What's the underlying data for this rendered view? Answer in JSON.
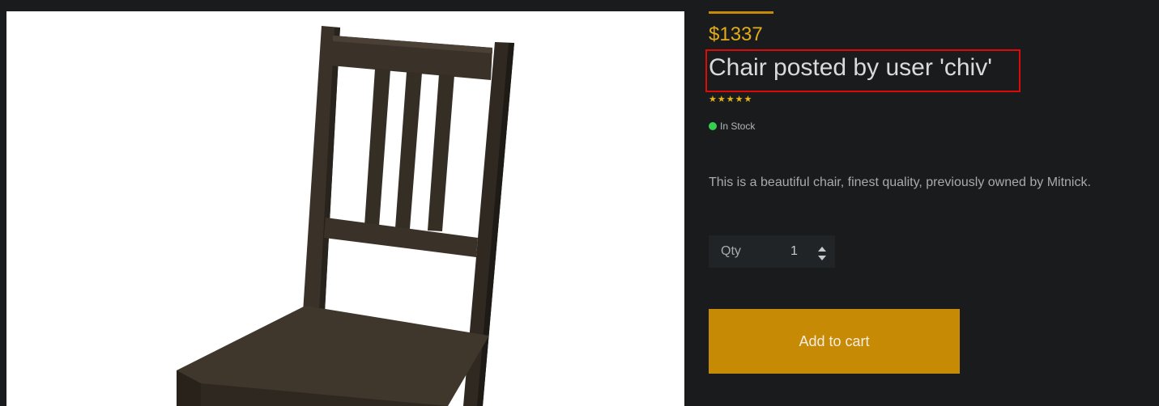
{
  "product": {
    "image_alt": "chair-photo",
    "price": "$1337",
    "title": "Chair posted by user 'chiv'",
    "rating_stars": "★★★★★",
    "rating": 5,
    "stock_status": "In Stock",
    "description": "This is a beautiful chair, finest quality, previously owned by Mitnick."
  },
  "purchase": {
    "qty_label": "Qty",
    "qty_value": "1",
    "add_to_cart_label": "Add to cart"
  },
  "colors": {
    "accent": "#c68a04",
    "price": "#e2ac19",
    "in_stock": "#35cf4e",
    "highlight_border": "#dd0a0a",
    "background": "#191b1d"
  },
  "icons": {
    "qty_increment": "caret-up-icon",
    "qty_decrement": "caret-down-icon",
    "stock_indicator": "green-dot-icon"
  }
}
